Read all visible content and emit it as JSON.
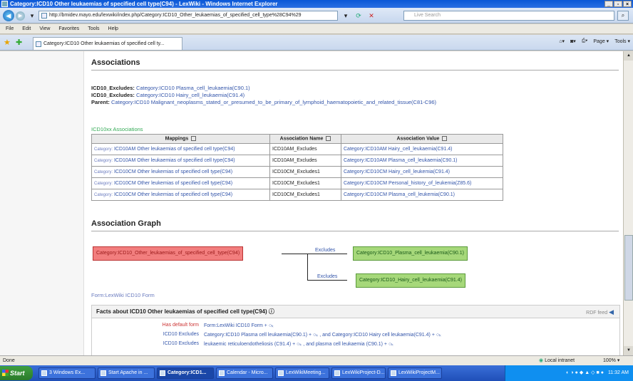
{
  "window": {
    "title": "Category:ICD10 Other leukaemias of specified cell type(C94) - LexWiki - Windows Internet Explorer"
  },
  "address": {
    "url": "http://bmidev.mayo.edu/lexwiki/index.php/Category:ICD10_Other_leukaemias_of_specified_cell_type%28C94%29",
    "search_placeholder": "Live Search"
  },
  "menu": [
    "File",
    "Edit",
    "View",
    "Favorites",
    "Tools",
    "Help"
  ],
  "tab": {
    "title": "Category:ICD10 Other leukaemias of specified cell ty..."
  },
  "commands": [
    "Page",
    "Tools"
  ],
  "associations": {
    "heading": "Associations",
    "lines": [
      {
        "label": "ICD10_Excludes:",
        "link": "Category:ICD10 Plasma_cell_leukaemia(C90.1)"
      },
      {
        "label": "ICD10_Excludes:",
        "link": "Category:ICD10 Hairy_cell_leukaemia(C91.4)"
      },
      {
        "label": "Parent:",
        "link": "Category:ICD10 Malignant_neoplasms_stated_or_presumed_to_be_primary_of_lymphoid_haematopoietic_and_related_tissue(C81-C96)"
      }
    ],
    "table_caption": "ICD10xx Associations",
    "columns": [
      "Mappings",
      "Association Name",
      "Association Value"
    ],
    "rows": [
      {
        "prefix": "Category:",
        "mapping": "ICD10AM Other leukaemias of specified cell type(C94)",
        "name": "ICD10AM_Excludes",
        "value": "Category:ICD10AM Hairy_cell_leukaemia(C91.4)"
      },
      {
        "prefix": "Category:",
        "mapping": "ICD10AM Other leukaemias of specified cell type(C94)",
        "name": "ICD10AM_Excludes",
        "value": "Category:ICD10AM Plasma_cell_leukaemia(C90.1)"
      },
      {
        "prefix": "Category:",
        "mapping": "ICD10CM Other leukemias of specified cell type(C94)",
        "name": "ICD10CM_Excludes1",
        "value": "Category:ICD10CM Hairy_cell_leukemia(C91.4)"
      },
      {
        "prefix": "Category:",
        "mapping": "ICD10CM Other leukemias of specified cell type(C94)",
        "name": "ICD10CM_Excludes1",
        "value": "Category:ICD10CM Personal_history_of_leukemia(Z85.6)"
      },
      {
        "prefix": "Category:",
        "mapping": "ICD10CM Other leukemias of specified cell type(C94)",
        "name": "ICD10CM_Excludes1",
        "value": "Category:ICD10CM Plasma_cell_leukemia(C90.1)"
      }
    ]
  },
  "graph": {
    "heading": "Association Graph",
    "source": "Category:ICD10_Other_leukaemias_of_specified_cell_type(C94)",
    "targets": [
      "Category:ICD10_Plasma_cell_leukaemia(C90.1)",
      "Category:ICD10_Hairy_cell_leukaemia(C91.4)"
    ],
    "edge_label": "Excludes"
  },
  "form_link": "Form:LexWiki ICD10 Form",
  "facts": {
    "title": "Facts about ICD10 Other leukaemias of specified cell type(C94)",
    "info_mark": "ⓘ",
    "rdf": "RDF feed",
    "rows": [
      {
        "key": "Has default form",
        "value": "Form:LexWiki ICD10 Form  + ○ₖ"
      },
      {
        "key": "ICD10 Excludes",
        "value": "Category:ICD10 Plasma cell leukaemia(C90.1)  + ○ₖ , and Category:ICD10 Hairy cell leukaemia(C91.4)  + ○ₖ"
      },
      {
        "key": "ICD10 Excludes",
        "value": "leukaemic reticuloendotheliosis (C91.4)  + ○ₖ , and plasma cell leukaemia (C90.1)  + ○ₖ"
      }
    ]
  },
  "status": {
    "left": "Done",
    "zone": "Local intranet",
    "zoom": "100%"
  },
  "taskbar": {
    "start": "Start",
    "buttons": [
      "3 Windows Ex...",
      "Start Apache in ...",
      "Category:ICD1...",
      "Calendar - Micro...",
      "LexWikiMeeting...",
      "LexWikiProject-D...",
      "LexWikiProjectM..."
    ],
    "clock": "11:32 AM"
  }
}
